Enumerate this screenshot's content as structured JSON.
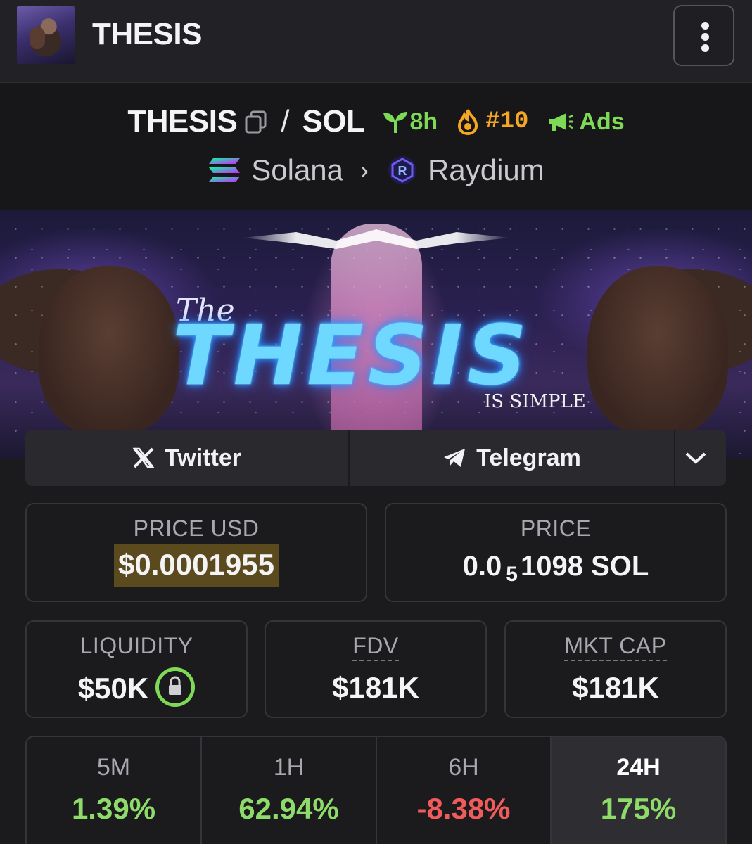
{
  "header": {
    "title": "THESIS"
  },
  "pair": {
    "base": "THESIS",
    "separator": "/",
    "quote": "SOL",
    "age": "8h",
    "rank": "#10",
    "ads": "Ads",
    "chain": "Solana",
    "dex": "Raydium"
  },
  "banner": {
    "alt_text": "The THESIS IS SIMPLE"
  },
  "social": {
    "twitter": "Twitter",
    "telegram": "Telegram"
  },
  "price_usd": {
    "label": "PRICE USD",
    "value": "$0.0001955"
  },
  "price_native": {
    "label": "PRICE",
    "prefix": "0.0",
    "zeros": "5",
    "digits": "1098",
    "unit": "SOL"
  },
  "liquidity": {
    "label": "LIQUIDITY",
    "value": "$50K"
  },
  "fdv": {
    "label": "FDV",
    "value": "$181K"
  },
  "mkt_cap": {
    "label": "MKT CAP",
    "value": "$181K"
  },
  "changes": [
    {
      "label": "5M",
      "value": "1.39%",
      "trend": "up"
    },
    {
      "label": "1H",
      "value": "62.94%",
      "trend": "up"
    },
    {
      "label": "6H",
      "value": "-8.38%",
      "trend": "down"
    },
    {
      "label": "24H",
      "value": "175%",
      "trend": "up",
      "active": true
    }
  ],
  "colors": {
    "positive": "#8fdb6a",
    "negative": "#f05b5b",
    "rank": "#f5a623",
    "age": "#7ed957",
    "highlight": "#5a4a1e"
  }
}
